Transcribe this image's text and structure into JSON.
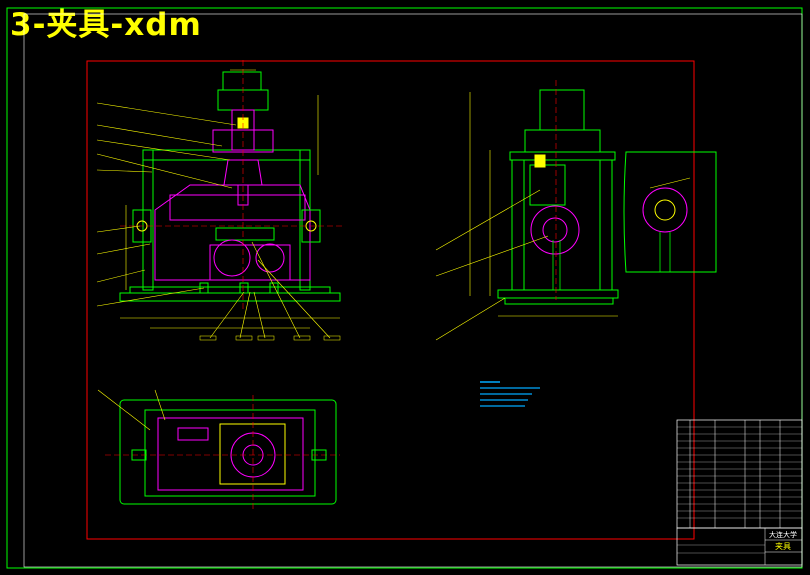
{
  "title": "3-夹具-xdm",
  "colors": {
    "background": "#000000",
    "outer_border": "#00ff00",
    "inner_border": "#ff0000",
    "title": "#ffff00",
    "part_outline": "#00ff00",
    "hidden_lines": "#ff00ff",
    "dimension": "#ffff00",
    "table": "#ffffff",
    "note": "#00aaff"
  },
  "title_block": {
    "school": "大连大学",
    "drawing_name": "夹具"
  }
}
